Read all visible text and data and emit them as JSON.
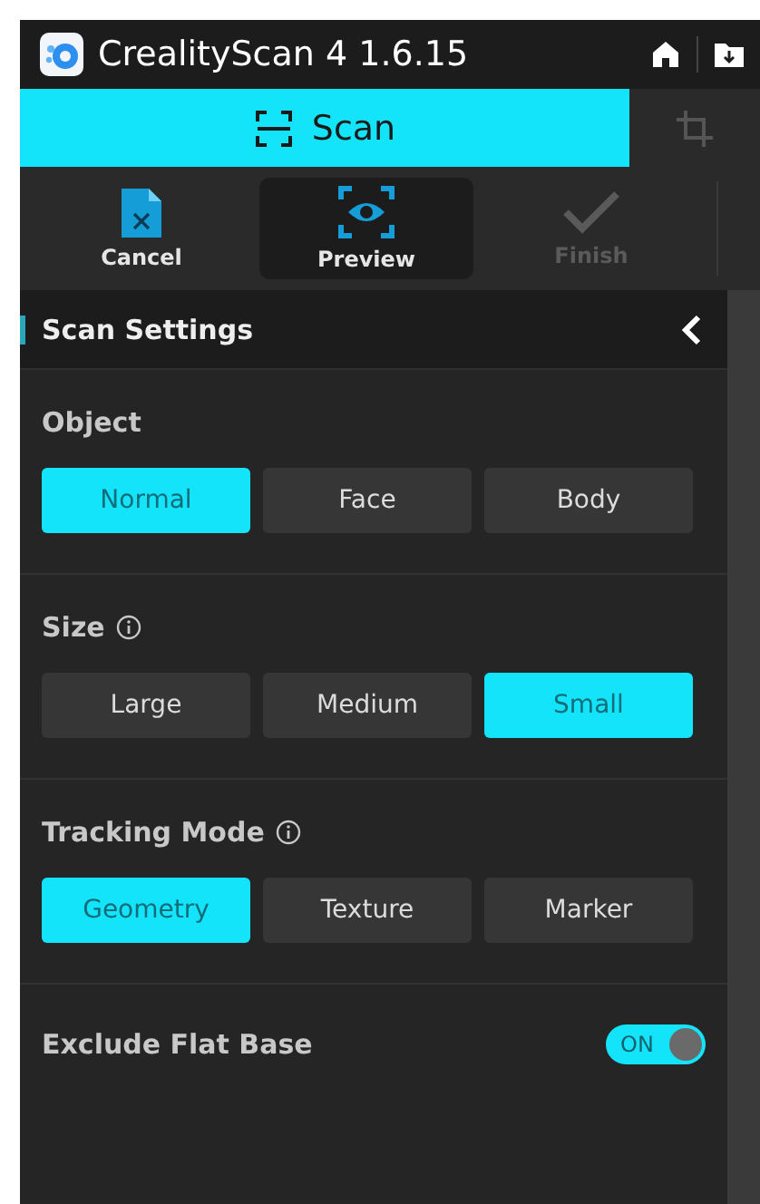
{
  "window": {
    "title": "CrealityScan 4 1.6.15"
  },
  "tabs": [
    {
      "label": "Scan",
      "selected": true,
      "kind": "scan"
    },
    {
      "selected": false,
      "kind": "crop"
    }
  ],
  "toolbar": [
    {
      "label": "Cancel",
      "kind": "cancel",
      "selected": false,
      "disabled": false
    },
    {
      "label": "Preview",
      "kind": "preview",
      "selected": true,
      "disabled": false
    },
    {
      "label": "Finish",
      "kind": "finish",
      "selected": false,
      "disabled": true
    }
  ],
  "panel": {
    "title": "Scan Settings",
    "sections": [
      {
        "label": "Object",
        "info": false,
        "kind": "choice",
        "options": [
          {
            "label": "Normal",
            "selected": true
          },
          {
            "label": "Face",
            "selected": false
          },
          {
            "label": "Body",
            "selected": false
          }
        ]
      },
      {
        "label": "Size",
        "info": true,
        "kind": "choice",
        "options": [
          {
            "label": "Large",
            "selected": false
          },
          {
            "label": "Medium",
            "selected": false
          },
          {
            "label": "Small",
            "selected": true
          }
        ]
      },
      {
        "label": "Tracking Mode",
        "info": true,
        "kind": "choice",
        "options": [
          {
            "label": "Geometry",
            "selected": true
          },
          {
            "label": "Texture",
            "selected": false
          },
          {
            "label": "Marker",
            "selected": false
          }
        ]
      },
      {
        "label": "Exclude Flat Base",
        "kind": "toggle",
        "on": true,
        "state_label": "ON"
      }
    ]
  }
}
